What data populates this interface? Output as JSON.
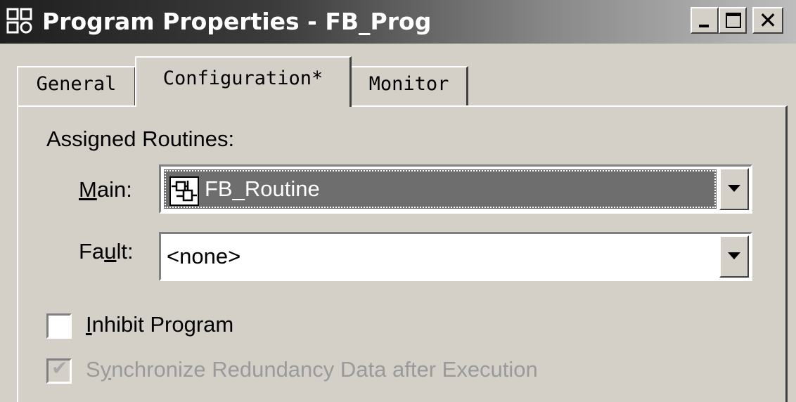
{
  "window": {
    "title": "Program Properties - FB_Prog",
    "controls": {
      "minimize_icon": "minimize-icon",
      "maximize_icon": "maximize-icon",
      "close_label": "✕"
    }
  },
  "tabs": [
    {
      "label": "General",
      "active": false
    },
    {
      "label": "Configuration*",
      "active": true
    },
    {
      "label": "Monitor",
      "active": false
    }
  ],
  "config": {
    "assigned_label": "Assigned Routines:",
    "main": {
      "label_pre": "",
      "label_hotkey": "M",
      "label_post": "ain:",
      "value": "FB_Routine",
      "icon": "function-block-icon"
    },
    "fault": {
      "label_pre": "Fa",
      "label_hotkey": "u",
      "label_post": "lt:",
      "value": "<none>"
    },
    "inhibit": {
      "label_pre": "",
      "label_hotkey": "I",
      "label_post": "nhibit Program",
      "checked": false
    },
    "sync": {
      "label_pre": "S",
      "label_hotkey": "y",
      "label_post": "nchronize Redundancy Data after Execution",
      "checked": true,
      "disabled": true
    }
  },
  "colors": {
    "face": "#d4d0c8",
    "selection": "#6e6e6e",
    "disabled_text": "#9a9a9a"
  }
}
